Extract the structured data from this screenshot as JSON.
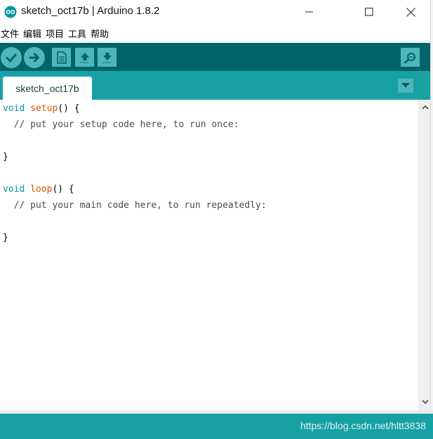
{
  "window": {
    "title": "sketch_oct17b | Arduino 1.8.2"
  },
  "menu": {
    "items": [
      "文件",
      "编辑",
      "项目",
      "工具",
      "帮助"
    ]
  },
  "toolbar": {
    "buttons": [
      "verify",
      "upload",
      "new",
      "open",
      "save"
    ],
    "right_button": "serial-monitor"
  },
  "tabs": {
    "active": "sketch_oct17b"
  },
  "editor": {
    "lines": {
      "l1": {
        "kw": "void",
        "fn": "setup",
        "rest": "() {"
      },
      "l2": {
        "comment": "  // put your setup code here, to run once:"
      },
      "l3": {
        "text": ""
      },
      "l4": {
        "text": "}"
      },
      "l5": {
        "text": ""
      },
      "l6": {
        "kw": "void",
        "fn": "loop",
        "rest": "() {"
      },
      "l7": {
        "comment": "  // put your main code here, to run repeatedly:"
      },
      "l8": {
        "text": ""
      },
      "l9": {
        "text": "}"
      }
    }
  },
  "status": {
    "watermark": "https://blog.csdn.net/hltt3838"
  },
  "colors": {
    "toolbar": "#006468",
    "tabstrip": "#17a1a5",
    "button": "#4db7bb",
    "keyword": "#00979c",
    "function": "#d35400"
  }
}
